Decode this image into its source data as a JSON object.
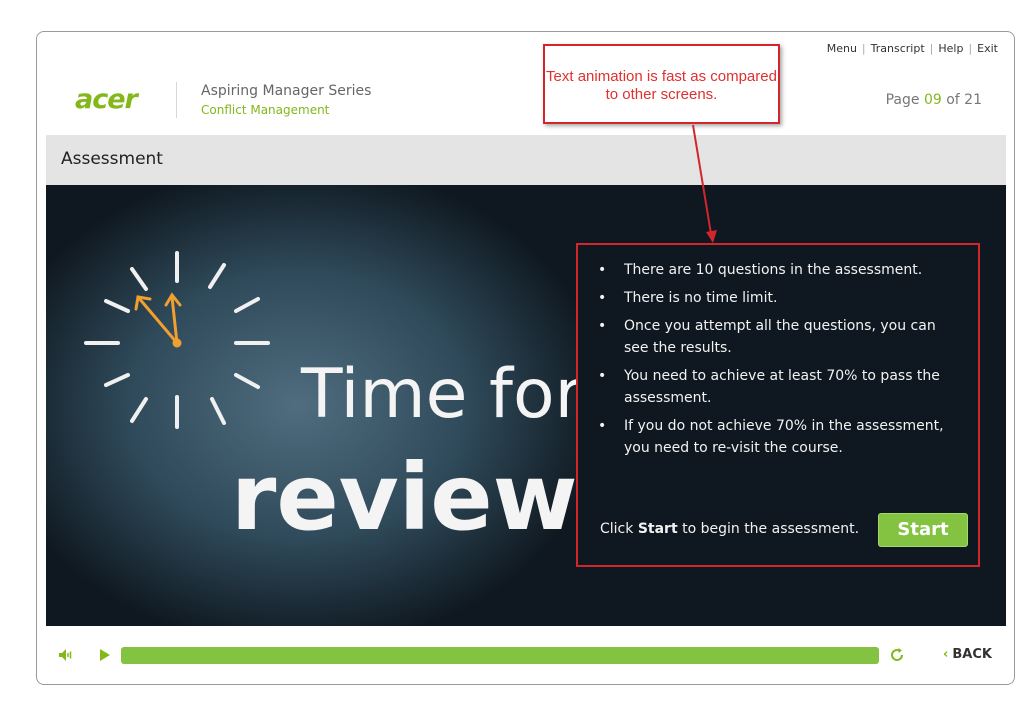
{
  "nav": {
    "menu": "Menu",
    "transcript": "Transcript",
    "help": "Help",
    "exit": "Exit"
  },
  "brand": {
    "logo": "acer",
    "series": "Aspiring Manager Series",
    "course": "Conflict Management"
  },
  "page": {
    "label": "Page",
    "current": "09",
    "of": "of",
    "total": "21"
  },
  "section": {
    "title": "Assessment"
  },
  "image": {
    "line1": "Time for",
    "line2": "review"
  },
  "panel": {
    "bullets": [
      "There are 10 questions in the assessment.",
      "There is no time limit.",
      "Once you attempt all the questions, you can see the results.",
      "You need to achieve at least 70% to pass the assessment.",
      "If you do not achieve 70% in the assessment, you need to re-visit the course."
    ],
    "cta_prefix": "Click ",
    "cta_bold": "Start",
    "cta_suffix": " to begin the assessment.",
    "start_label": "Start"
  },
  "callout": {
    "text": "Text animation is fast as compared to other screens."
  },
  "controls": {
    "back_label": "BACK",
    "progress": 1.0
  },
  "colors": {
    "accent": "#83b81a",
    "button": "#83c341",
    "annotation": "#d3262c",
    "stage": "#0f1820"
  }
}
